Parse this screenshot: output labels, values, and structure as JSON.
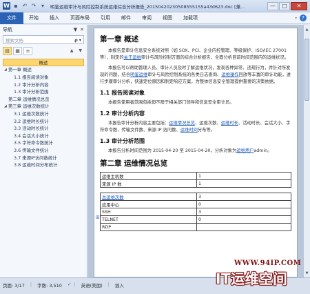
{
  "window": {
    "title": "明鉴运维审计与风险控制系统运维综合分析报告_20150420230508555155a43d623.doc [兼...",
    "controls": [
      "—",
      "□",
      "✕"
    ]
  },
  "ribbon": {
    "file_tab": "文件",
    "tabs": [
      "开始",
      "插入",
      "页面布局",
      "引用",
      "邮件",
      "审阅",
      "视图",
      "加载项"
    ],
    "right_icons": [
      "caret-icon",
      "help-icon"
    ],
    "help_glyph": "?"
  },
  "nav": {
    "title": "导航",
    "controls": [
      "▼",
      "✕"
    ],
    "search_placeholder": "搜索文档",
    "search_glyph": "ρ",
    "search_dropdown": "▾",
    "arrows": "▲ ▼",
    "tree": [
      {
        "label": "概述",
        "selected": true,
        "level": 0
      },
      {
        "label": "第一章 概述",
        "level": 0,
        "expanded": true
      },
      {
        "label": "1.1 报告阅读对象",
        "level": 1
      },
      {
        "label": "1.2 审计分析内容",
        "level": 1
      },
      {
        "label": "1.3 审计分析范围",
        "level": 1
      },
      {
        "label": "第二章 运维情况总览",
        "level": 0
      },
      {
        "label": "第三章 运维次数统计",
        "level": 0,
        "expanded": true
      },
      {
        "label": "3.1 运维次数统计",
        "level": 1
      },
      {
        "label": "3.2 运维时长统计",
        "level": 1
      },
      {
        "label": "3.3 活动时长统计",
        "level": 1
      },
      {
        "label": "3.4 会话大小统计",
        "level": 1
      },
      {
        "label": "3.5 字符命令数统计",
        "level": 1
      },
      {
        "label": "3.6 传输文件统计",
        "level": 1
      },
      {
        "label": "3.7 来源IP访问数统计",
        "level": 1
      },
      {
        "label": "3.8 运维时间分布统计",
        "level": 1
      }
    ]
  },
  "document": {
    "ch1_title": "第一章 概述",
    "p1_parts": [
      "本报告是审计信息安全系统对照（如 SOX、PCI、企业内控管理、等级保护、ISO/IEC 27001 等），制定的",
      "关于运维",
      "审计与风险控制方面的综合分析报告，全面分析目前时间范围内的运维状况。"
    ],
    "p2_parts": [
      "本报告可以帮助管理人员、审计人员及时了解运维状况，发现各种异常、违规行为，并针对所发现的问题，结合",
      "明鉴运维",
      "审计与风险控制系统的各类日志查询、",
      "运维操作",
      "回放等丰富的审计功能，进行步骤审计分析，快速定位原因和制定响应方案，为整体信息安全管理提供重要的决策依据。"
    ],
    "s11": "1.1 报告阅读对象",
    "p3": "本报告使用者范围包括但不限于相关部门领导和信息安全审计员。",
    "s12": "1.2 审计分析内容",
    "p4_parts": [
      "本报告审计分析内容主要包括：",
      "运维情况总览",
      "、运维次数、",
      "运维时长",
      "、活动时长、会话大小、字符命令数、传输文件数、来源 IP 访问数、",
      "运维时间",
      "分布等。"
    ],
    "s13": "1.3 审计分析范围",
    "p5_parts": [
      "本报告分析时间范围为 2015-04-20 至 2015-04-20，分析对象为",
      "运维用户",
      "admin。"
    ],
    "ch2_title": "第二章 运维情况总览",
    "table1": [
      [
        "运维主机数",
        "1"
      ],
      [
        "来源 IP 数",
        "1"
      ]
    ],
    "table2": [
      [
        "总运维次数",
        "3"
      ],
      [
        "应用中心",
        "0"
      ],
      [
        "SSH",
        "3"
      ],
      [
        "TELNET",
        "0"
      ],
      [
        "RDP",
        ""
      ]
    ]
  },
  "statusbar": {
    "page": "页面: 3/17",
    "words": "字数: 3,510",
    "lang": "英语(美国)",
    "mode": "插入"
  },
  "watermark": {
    "url": "WWW.94IP.COM",
    "name": "IT运维空间"
  }
}
